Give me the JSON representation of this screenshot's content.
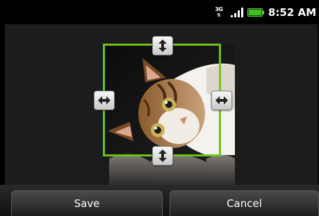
{
  "status_bar": {
    "network_type": "3G",
    "network_arrows": "⇅",
    "signal_icon": "signal-bars-icon",
    "battery_icon": "battery-icon",
    "time": "8:52 AM",
    "colors": {
      "battery": "#3fbf1f"
    }
  },
  "editor": {
    "image_subject": "cat",
    "crop_frame_color": "#6fc21b",
    "handles": {
      "top": "vertical-resize-icon",
      "bottom": "vertical-resize-icon",
      "left": "horizontal-resize-icon",
      "right": "horizontal-resize-icon"
    }
  },
  "actions": {
    "save_label": "Save",
    "cancel_label": "Cancel"
  }
}
